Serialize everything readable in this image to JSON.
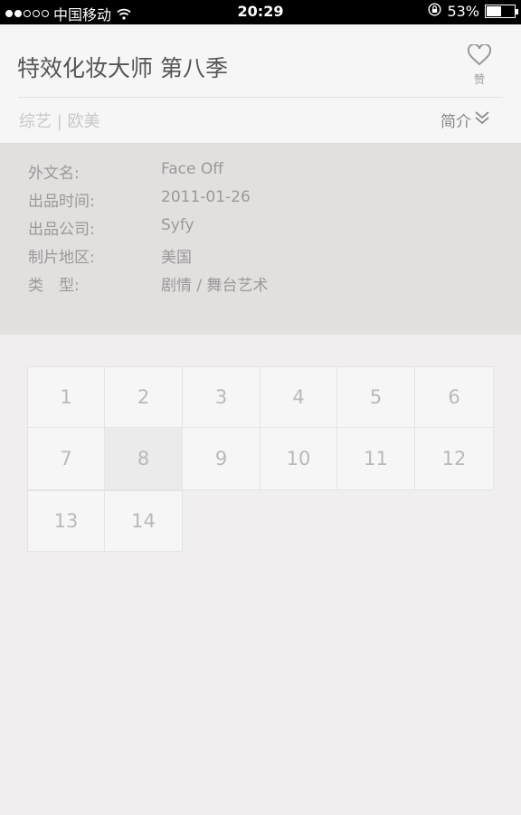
{
  "status_bar": {
    "carrier": "中国移动",
    "time": "20:29",
    "battery_percent": "53%",
    "battery_level": 0.53
  },
  "header": {
    "title": "特效化妆大师 第八季",
    "like_label": "赞",
    "tags": "综艺 | 欧美",
    "intro_label": "简介"
  },
  "info": [
    {
      "key": "外文名:",
      "value": "Face Off"
    },
    {
      "key": "出品时间:",
      "value": "2011-01-26"
    },
    {
      "key": "出品公司:",
      "value": "Syfy"
    },
    {
      "key": "制片地区:",
      "value": "美国"
    },
    {
      "key": "类　型:",
      "value": "剧情 / 舞台艺术"
    }
  ],
  "episodes": {
    "items": [
      "1",
      "2",
      "3",
      "4",
      "5",
      "6",
      "7",
      "8",
      "9",
      "10",
      "11",
      "12",
      "13",
      "14"
    ],
    "selected": "8"
  },
  "colors": {
    "header_bg": "#f6f6f6",
    "info_bg": "#e4dfdf",
    "page_bg": "#f0eeef"
  }
}
